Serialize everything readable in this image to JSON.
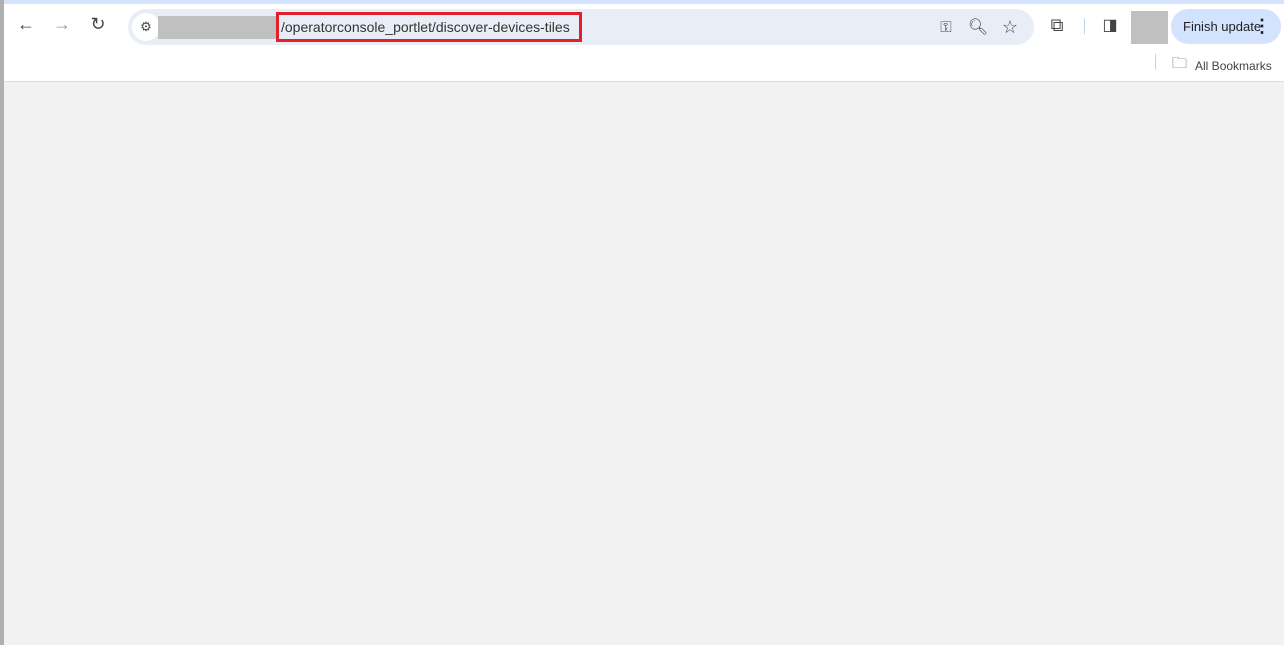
{
  "browser": {
    "url_path": "/operatorconsole_portlet/discover-devices-tiles",
    "finish_update_label": "Finish update",
    "bookmarks_label": "All Bookmarks"
  }
}
